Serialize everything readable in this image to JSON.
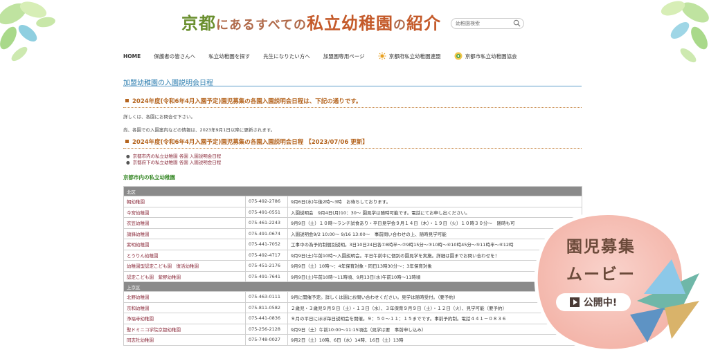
{
  "site": {
    "title_part1": "京都",
    "title_part2": "にあるすべての",
    "title_part3": "私立幼稚園",
    "title_part4": "の",
    "title_part5": "紹介",
    "search_placeholder": "幼稚園検索"
  },
  "nav": {
    "items": [
      "HOME",
      "保護者の皆さんへ",
      "私立幼稚園を探す",
      "先生になりたい方へ",
      "加盟園専用ページ",
      "京都府私立幼稚園連盟",
      "京都市私立幼稚園協会"
    ]
  },
  "page": {
    "heading": "加盟幼稚園の入園説明会日程",
    "section1": "2024年度(令和6年4月入園予定)園児募集の各園入園説明会日程は、下記の通りです。",
    "note1": "詳しくは、各園にお問合せ下さい。",
    "note2": "尚、各園での入園案内などの情報は、2023年9月1日以降に更新されます。",
    "section2": "2024年度(令和6年4月入園予定)園児募集の各園入園説明会日程 【2023/07/06 更新】",
    "links": [
      "京都市内の私立幼稚園 各園 入園説明会日程",
      "京都府下の私立幼稚園 各園 入園説明会日程"
    ],
    "subheading": "京都市内の私立幼稚園"
  },
  "table": {
    "rows": [
      {
        "type": "band",
        "label": "北区"
      },
      {
        "name": "朝幼稚園",
        "tel": "075-492-2786",
        "info": "9月6日(水)午後2時～3時　お待ちしております。"
      },
      {
        "name": "今宮幼稚園",
        "tel": "075-491-0551",
        "info": "入園説明会　9月4日(月)10：30～ 園見学は随時可能です。電話にてお申し出ください。"
      },
      {
        "name": "衣笠幼稚園",
        "tel": "075-461-2243",
        "info": "9月9日（土）１０時～ランチ試食あり・平日見学会９月１４日（木）・１９日（火）１０時３０分～　随時も可"
      },
      {
        "name": "旗鋒幼稚園",
        "tel": "075-491-0674",
        "info": "入園説明会9/2 10:00～ 9/16 13:00～　事前問い合わせの上、随時見学可能"
      },
      {
        "name": "紫明幼稚園",
        "tel": "075-441-7052",
        "info": "工事中の為予約制個別説明。3日10日24日各①8時半～②9時15分～③10時～④10時45分～⑤11時半～⑥12時"
      },
      {
        "name": "とうりん幼稚園",
        "tel": "075-492-4717",
        "info": "9月9日(土)午前10時～入園説明会。平日午前中に個別の園見学を実施。詳細は園までお問い合わせを！"
      },
      {
        "name": "幼稚園型認定こども園　復活幼稚園",
        "tel": "075-451-2176",
        "info": "9月9日（土）10時～：4年保育対象・同日13時30分～：3年保育対象"
      },
      {
        "name": "認定こども園　紫野幼稚園",
        "tel": "075-491-7641",
        "info": "9月9日(土)午前10時～11時頃、9月13日(水)午前10時～11時頃"
      },
      {
        "type": "band",
        "label": "上京区"
      },
      {
        "name": "北野幼稚園",
        "tel": "075-463-0111",
        "info": "9月に開催予定。詳しくは園にお問い合わせください。見学は随時受付。（要予約）"
      },
      {
        "name": "京和幼稚園",
        "tel": "075-811-0582",
        "info": "２歳児・３歳児９月９日（土）・１３日（水）、３年保育９月９日（土）・１２日（火）、見学可能（要予約）"
      },
      {
        "name": "浄福寺幼稚園",
        "tel": "075-441-0836",
        "info": "９月の平日にほぼ毎日説明会を開催。９：５０～１１：１５までです。事前予約制。電話４４１－０８３６"
      },
      {
        "name": "聖ドミニコ学院京都幼稚園",
        "tel": "075-256-2128",
        "info": "9月9日（土）午前10:00～11:15頃迄（見学は要　事前申し込み）"
      },
      {
        "name": "同志社幼稚園",
        "tel": "075-748-0027",
        "info": "9月2日（土）10時、6日（水）14時、16日（土）13時"
      }
    ]
  },
  "banner": {
    "line1": "園児募集",
    "line2": "ムービー",
    "button": "公開中!"
  }
}
